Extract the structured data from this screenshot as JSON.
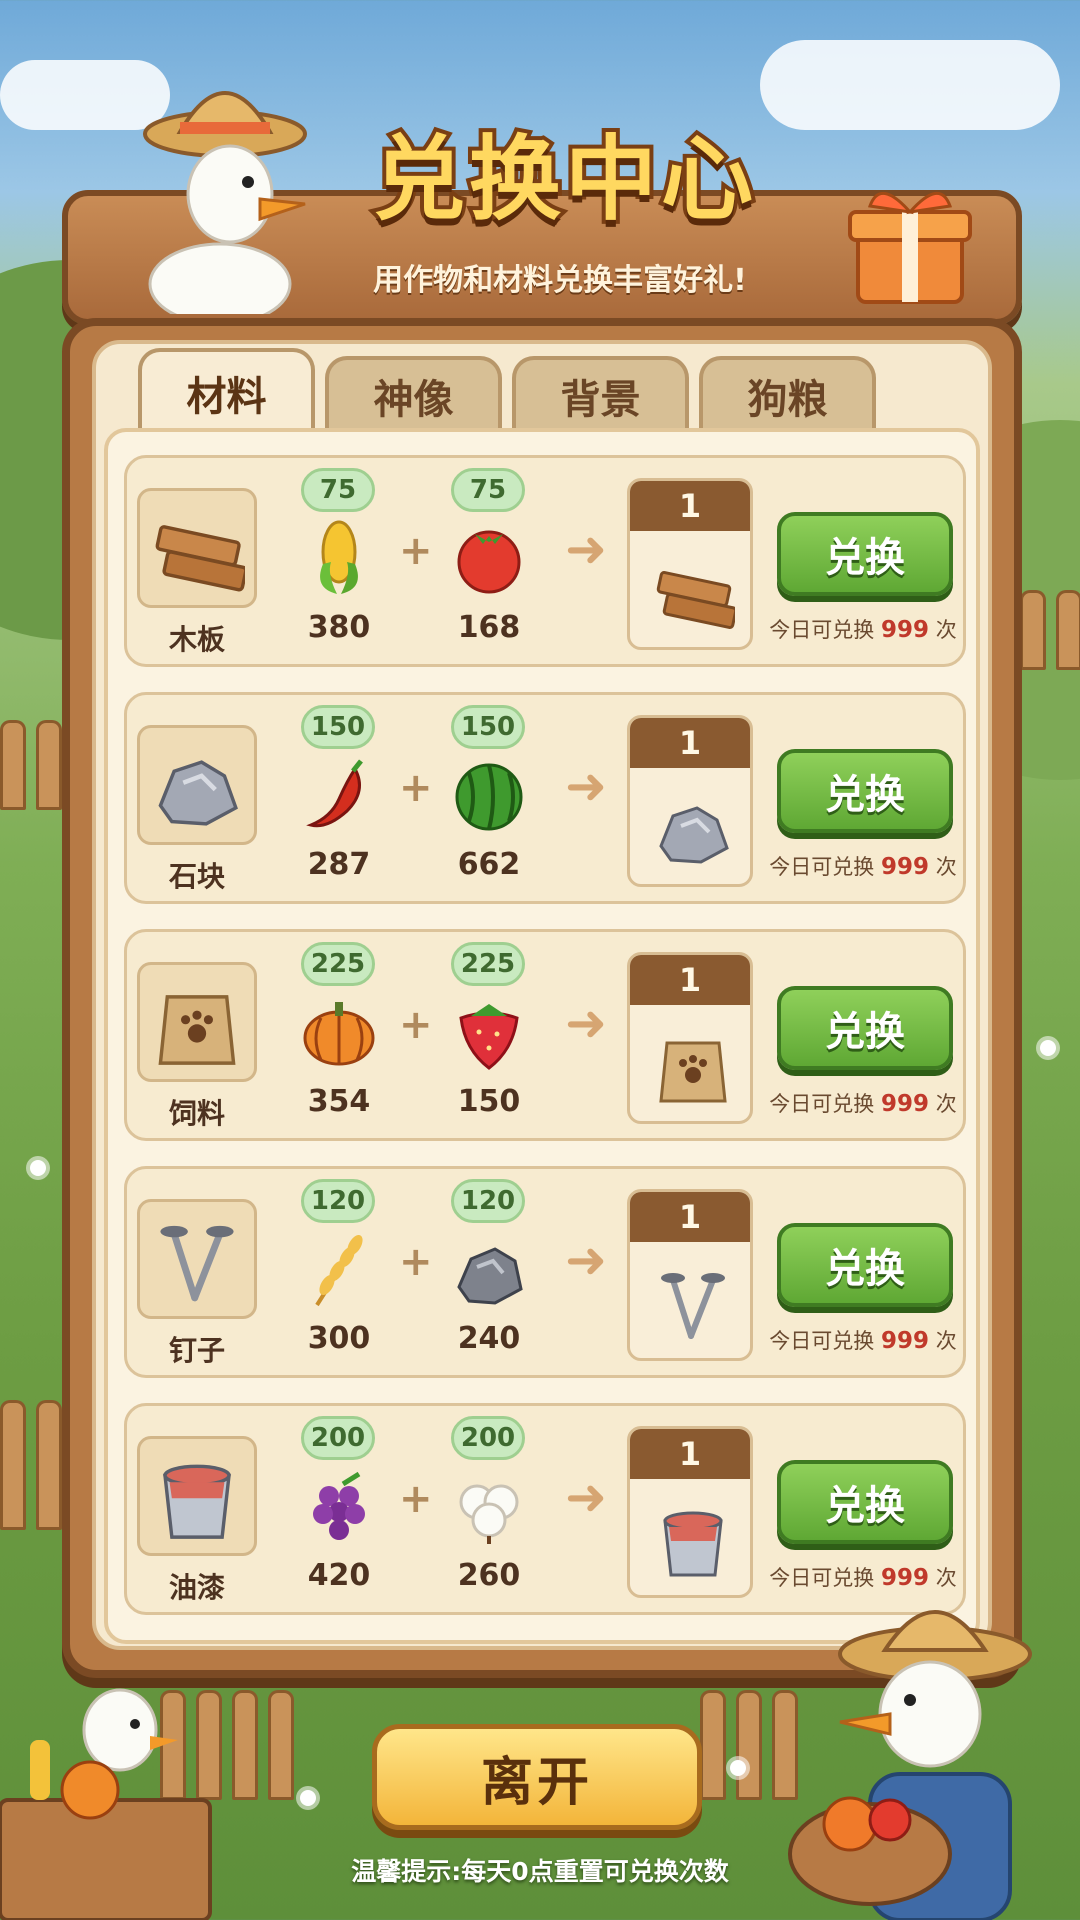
{
  "header": {
    "title": "兑换中心",
    "subtitle": "用作物和材料兑换丰富好礼!"
  },
  "tabs": [
    {
      "label": "材料",
      "active": true
    },
    {
      "label": "神像",
      "active": false
    },
    {
      "label": "背景",
      "active": false
    },
    {
      "label": "狗粮",
      "active": false
    }
  ],
  "rows": [
    {
      "name": "木板",
      "icon": "wood-plank-icon",
      "ingredient1": {
        "icon": "corn-icon",
        "cost": "75",
        "owned": "380"
      },
      "ingredient2": {
        "icon": "tomato-icon",
        "cost": "75",
        "owned": "168"
      },
      "result_qty": "1",
      "button": "兑换",
      "limit_prefix": "今日可兑换",
      "limit_value": "999",
      "limit_suffix": "次"
    },
    {
      "name": "石块",
      "icon": "stone-icon",
      "ingredient1": {
        "icon": "chili-icon",
        "cost": "150",
        "owned": "287"
      },
      "ingredient2": {
        "icon": "watermelon-icon",
        "cost": "150",
        "owned": "662"
      },
      "result_qty": "1",
      "button": "兑换",
      "limit_prefix": "今日可兑换",
      "limit_value": "999",
      "limit_suffix": "次"
    },
    {
      "name": "饲料",
      "icon": "feed-bag-icon",
      "ingredient1": {
        "icon": "pumpkin-icon",
        "cost": "225",
        "owned": "354"
      },
      "ingredient2": {
        "icon": "strawberry-icon",
        "cost": "225",
        "owned": "150"
      },
      "result_qty": "1",
      "button": "兑换",
      "limit_prefix": "今日可兑换",
      "limit_value": "999",
      "limit_suffix": "次"
    },
    {
      "name": "钉子",
      "icon": "nails-icon",
      "ingredient1": {
        "icon": "wheat-icon",
        "cost": "120",
        "owned": "300"
      },
      "ingredient2": {
        "icon": "ore-icon",
        "cost": "120",
        "owned": "240"
      },
      "result_qty": "1",
      "button": "兑换",
      "limit_prefix": "今日可兑换",
      "limit_value": "999",
      "limit_suffix": "次"
    },
    {
      "name": "油漆",
      "icon": "paint-bucket-icon",
      "ingredient1": {
        "icon": "grape-icon",
        "cost": "200",
        "owned": "420"
      },
      "ingredient2": {
        "icon": "cotton-icon",
        "cost": "200",
        "owned": "260"
      },
      "result_qty": "1",
      "button": "兑换",
      "limit_prefix": "今日可兑换",
      "limit_value": "999",
      "limit_suffix": "次"
    }
  ],
  "footer": {
    "leave_button": "离开",
    "tip": "温馨提示:每天0点重置可兑换次数"
  },
  "colors": {
    "accent_green": "#5fa834",
    "wood": "#b77a45",
    "limit_highlight": "#c0392b"
  }
}
